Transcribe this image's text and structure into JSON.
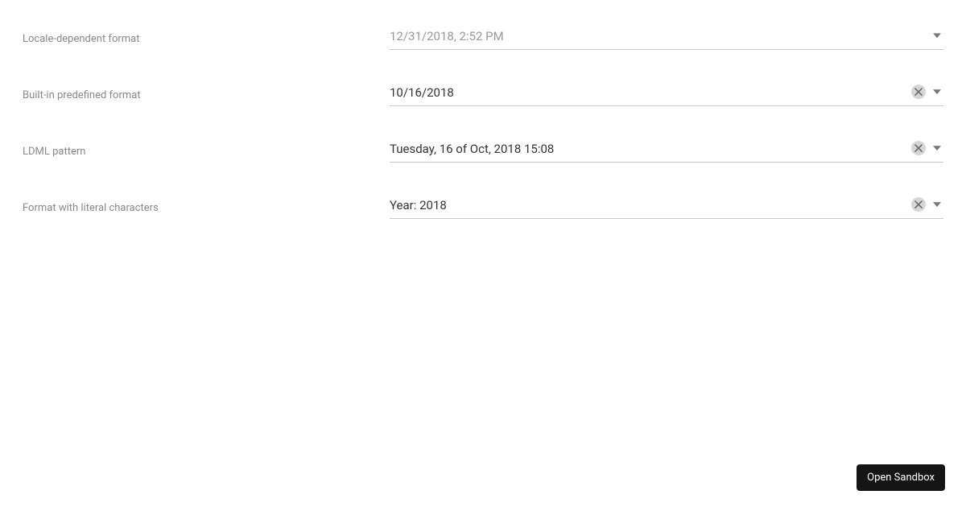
{
  "fields": [
    {
      "label": "Locale-dependent format",
      "value": "",
      "placeholder": "12/31/2018, 2:52 PM",
      "clearable": false
    },
    {
      "label": "Built-in predefined format",
      "value": "10/16/2018",
      "placeholder": "",
      "clearable": true
    },
    {
      "label": "LDML pattern",
      "value": "Tuesday, 16 of Oct, 2018 15:08",
      "placeholder": "",
      "clearable": true
    },
    {
      "label": "Format with literal characters",
      "value": "Year: 2018",
      "placeholder": "",
      "clearable": true
    }
  ],
  "sandbox_button": "Open Sandbox"
}
